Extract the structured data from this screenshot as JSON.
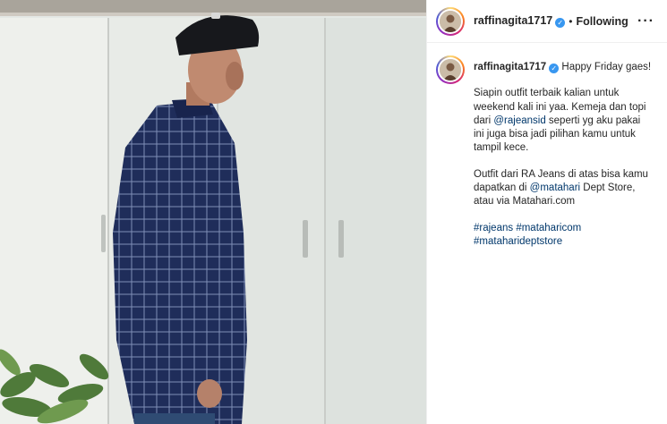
{
  "post": {
    "username": "raffinagita1717",
    "separator": "•",
    "following_label": "Following",
    "more_label": "···"
  },
  "caption": {
    "username": "raffinagita1717",
    "first_line": "Happy Friday gaes!",
    "para1": {
      "line1": "Siapin outfit terbaik kalian untuk",
      "line2": "weekend kali ini yaa. Kemeja dan topi",
      "line3_prefix": "dari ",
      "line3_mention": "@rajeansid",
      "line3_suffix": " seperti yg aku pakai",
      "line4": "ini juga bisa jadi pilihan kamu untuk",
      "line5": "tampil kece."
    },
    "para2": {
      "line1": "Outfit dari RA Jeans di atas bisa kamu",
      "line2_prefix": "dapatkan di ",
      "line2_mention": "@matahari",
      "line2_suffix": " Dept Store,",
      "line3": "atau via Matahari.com"
    },
    "hashtags": {
      "tag1": "#rajeans",
      "tag2": "#mataharicom",
      "tag3": "#mataharideptstore"
    }
  },
  "colors": {
    "link": "#00376b",
    "verified": "#3897f0",
    "shirt": "#1f2d5a"
  },
  "icons": {
    "verified": "verified-badge-icon",
    "more": "more-options-icon"
  }
}
